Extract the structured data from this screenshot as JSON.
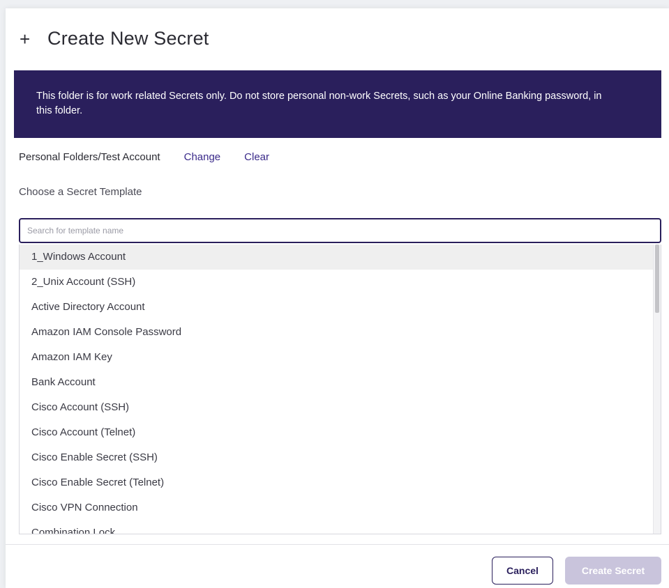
{
  "dialog": {
    "title": "Create New Secret",
    "icon": "plus-icon"
  },
  "banner": {
    "text": "This folder is for work related Secrets only. Do not store personal non-work Secrets, such as your Online Banking password, in this folder.",
    "color": "#2a1f5c"
  },
  "folder": {
    "path": "Personal Folders/Test Account",
    "change_label": "Change",
    "clear_label": "Clear"
  },
  "template": {
    "label": "Choose a Secret Template",
    "search_placeholder": "Search for template name",
    "search_value": "",
    "items": [
      "1_Windows Account",
      "2_Unix Account (SSH)",
      "Active Directory Account",
      "Amazon IAM Console Password",
      "Amazon IAM Key",
      "Bank Account",
      "Cisco Account (SSH)",
      "Cisco Account (Telnet)",
      "Cisco Enable Secret (SSH)",
      "Cisco Enable Secret (Telnet)",
      "Cisco VPN Connection",
      "Combination Lock"
    ],
    "selected_index": 0
  },
  "footer": {
    "cancel_label": "Cancel",
    "create_label": "Create Secret"
  }
}
